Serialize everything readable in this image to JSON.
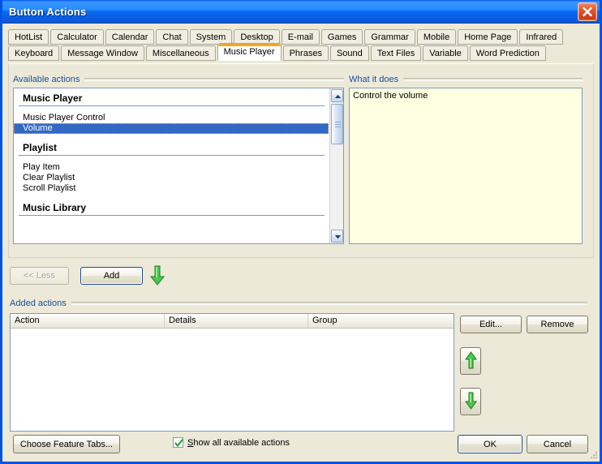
{
  "window": {
    "title": "Button Actions",
    "close_icon": "close-icon"
  },
  "tabs": {
    "row1": [
      {
        "label": "HotList",
        "active": false
      },
      {
        "label": "Calculator",
        "active": false
      },
      {
        "label": "Calendar",
        "active": false
      },
      {
        "label": "Chat",
        "active": false
      },
      {
        "label": "System",
        "active": false
      },
      {
        "label": "Desktop",
        "active": false
      },
      {
        "label": "E-mail",
        "active": false
      },
      {
        "label": "Games",
        "active": false
      },
      {
        "label": "Grammar",
        "active": false
      },
      {
        "label": "Mobile",
        "active": false
      },
      {
        "label": "Home Page",
        "active": false
      },
      {
        "label": "Infrared",
        "active": false
      }
    ],
    "row2": [
      {
        "label": "Keyboard",
        "active": false
      },
      {
        "label": "Message Window",
        "active": false
      },
      {
        "label": "Miscellaneous",
        "active": false
      },
      {
        "label": "Music Player",
        "active": true
      },
      {
        "label": "Phrases",
        "active": false
      },
      {
        "label": "Sound",
        "active": false
      },
      {
        "label": "Text Files",
        "active": false
      },
      {
        "label": "Variable",
        "active": false
      },
      {
        "label": "Word Prediction",
        "active": false
      }
    ],
    "active_tab": "Music Player"
  },
  "available": {
    "label": "Available actions",
    "groups": [
      {
        "header": "Music Player",
        "items": [
          {
            "label": "Music Player Control",
            "selected": false
          },
          {
            "label": "Volume",
            "selected": true
          }
        ]
      },
      {
        "header": "Playlist",
        "items": [
          {
            "label": "Play Item",
            "selected": false
          },
          {
            "label": "Clear Playlist",
            "selected": false
          },
          {
            "label": "Scroll Playlist",
            "selected": false
          }
        ]
      },
      {
        "header": "Music Library",
        "items": []
      }
    ],
    "scrollbar": {
      "up_icon": "chevron-up-icon",
      "down_icon": "chevron-down-icon"
    }
  },
  "what_it_does": {
    "label": "What it does",
    "text": "Control the volume"
  },
  "action_buttons": {
    "less_label": "<< Less",
    "less_disabled": true,
    "add_label": "Add",
    "add_focused": true,
    "hint_icon": "green-down-arrow-icon"
  },
  "added": {
    "label": "Added actions",
    "columns": [
      "Action",
      "Details",
      "Group"
    ],
    "rows": [],
    "edit_label": "Edit...",
    "remove_label": "Remove",
    "move_up_icon": "green-up-arrow-icon",
    "move_down_icon": "green-down-arrow-icon"
  },
  "footer": {
    "choose_tabs_label": "Choose Feature Tabs...",
    "checkbox_label_prefix": "S",
    "checkbox_label_rest": "how all available actions",
    "checkbox_checked": true,
    "ok_label": "OK",
    "cancel_label": "Cancel"
  },
  "colors": {
    "titlebar_blue": "#0a68f0",
    "window_border": "#0054e3",
    "dialog_face": "#ece9d8",
    "group_label_blue": "#15509b",
    "selection_blue": "#3169c6",
    "tooltip_yellow": "#ffffe1",
    "active_tab_accent": "#f5a623",
    "arrow_green": "#3fbf3f"
  }
}
